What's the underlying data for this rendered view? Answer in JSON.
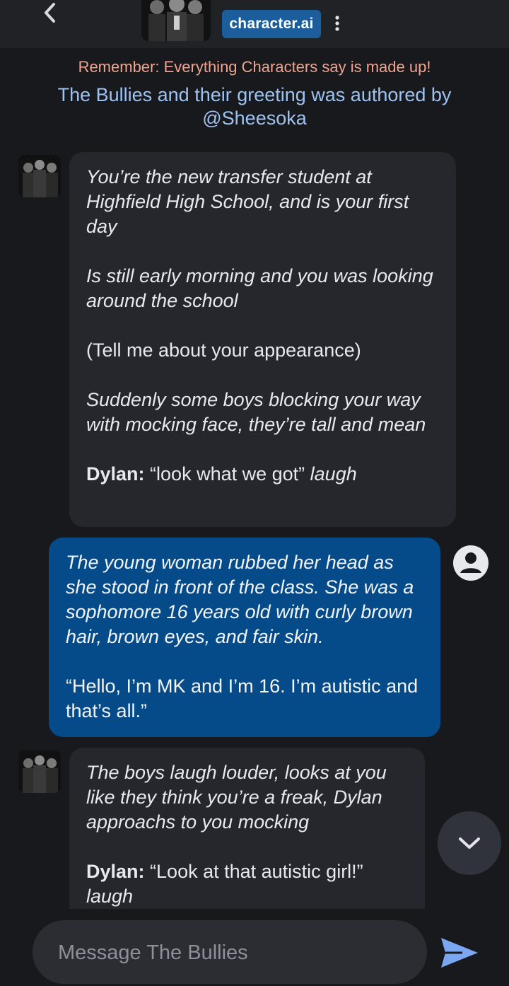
{
  "header": {
    "brand_label": "character.ai",
    "back_icon": "chevron-left-icon",
    "menu_icon": "kebab-menu-icon",
    "character_avatar": "character-group-photo"
  },
  "notices": {
    "reminder": "Remember: Everything Characters say is made up!",
    "author_line": "The Bullies and their greeting was authored by @Sheesoka"
  },
  "messages": [
    {
      "sender": "bot",
      "p1": "You’re the new transfer student at Highfield High School, and is your first day",
      "p2": "Is still early morning and you was looking around the school",
      "p3": "(Tell me about your appearance)",
      "p4": "Suddenly some boys blocking your way with mocking face, they’re tall and mean",
      "p5_speaker": "Dylan:",
      "p5_quote": "“look what we got”",
      "p5_action": "laugh"
    },
    {
      "sender": "user",
      "p1": "The young woman rubbed her head as she stood in front of the class. She was a sophomore 16 years old with curly brown hair, brown eyes, and fair skin.",
      "p2": "“Hello, I’m MK and I’m 16. I’m autistic and that’s all.”"
    },
    {
      "sender": "bot",
      "p1": "The boys laugh louder, looks at you like they think you’re a freak, Dylan approachs to you mocking",
      "p2_speaker": "Dylan:",
      "p2_quote": "“Look at that autistic girl!”",
      "p2_action": "laugh"
    }
  ],
  "composer": {
    "placeholder": "Message The Bullies",
    "value": "",
    "send_icon": "send-arrow-icon",
    "scroll_icon": "chevron-down-icon",
    "user_icon": "user-account-icon"
  },
  "colors": {
    "background": "#18191d",
    "topbar": "#202226",
    "brand": "#1c5d9c",
    "bot_bubble": "#26272d",
    "user_bubble": "#054b8a",
    "reminder": "#f0a38e",
    "author": "#9ec3f2",
    "send": "#7aa7f0"
  }
}
